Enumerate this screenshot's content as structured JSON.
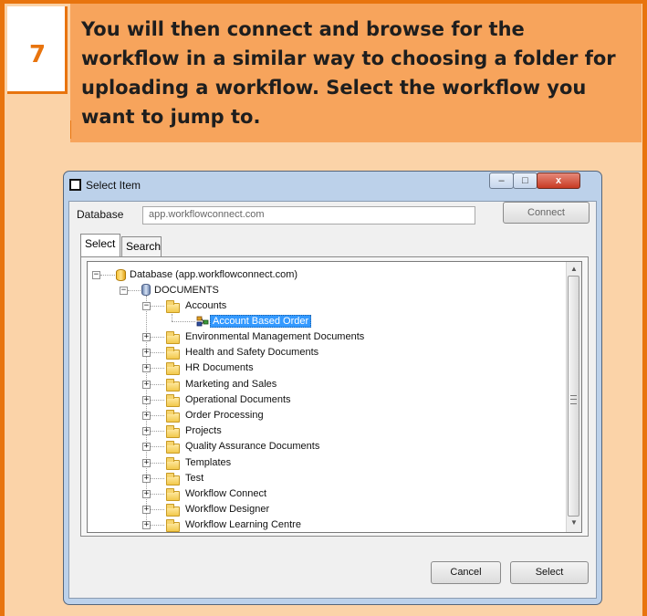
{
  "step": {
    "number": "7"
  },
  "instruction": {
    "text": "You will then connect and browse for the workflow in a similar way to choosing a folder for uploading a workflow. Select the workflow you want to jump to."
  },
  "window": {
    "title": "Select Item",
    "controls": {
      "minimize": "–",
      "maximize": "□",
      "close": "x"
    }
  },
  "database": {
    "label": "Database",
    "value": "app.workflowconnect.com",
    "connect_label": "Connect"
  },
  "tabs": [
    {
      "label": "Select",
      "selected": true
    },
    {
      "label": "Search",
      "selected": false
    }
  ],
  "tree": {
    "root": "Database (app.workflowconnect.com)",
    "documents": "DOCUMENTS",
    "accounts": "Accounts",
    "selected_item": "Account Based Order",
    "folders": [
      "Environmental Management Documents",
      "Health and Safety Documents",
      "HR Documents",
      "Marketing and Sales",
      "Operational Documents",
      "Order Processing",
      "Projects",
      "Quality Assurance Documents",
      "Templates",
      "Test",
      "Workflow Connect",
      "Workflow Designer",
      "Workflow Learning Centre"
    ]
  },
  "buttons": {
    "cancel": "Cancel",
    "select": "Select"
  },
  "colors": {
    "accent": "#E8740E",
    "card_bg": "#FBD3A8",
    "instruction_bg": "#F7A45C",
    "selection": "#3399FF"
  }
}
